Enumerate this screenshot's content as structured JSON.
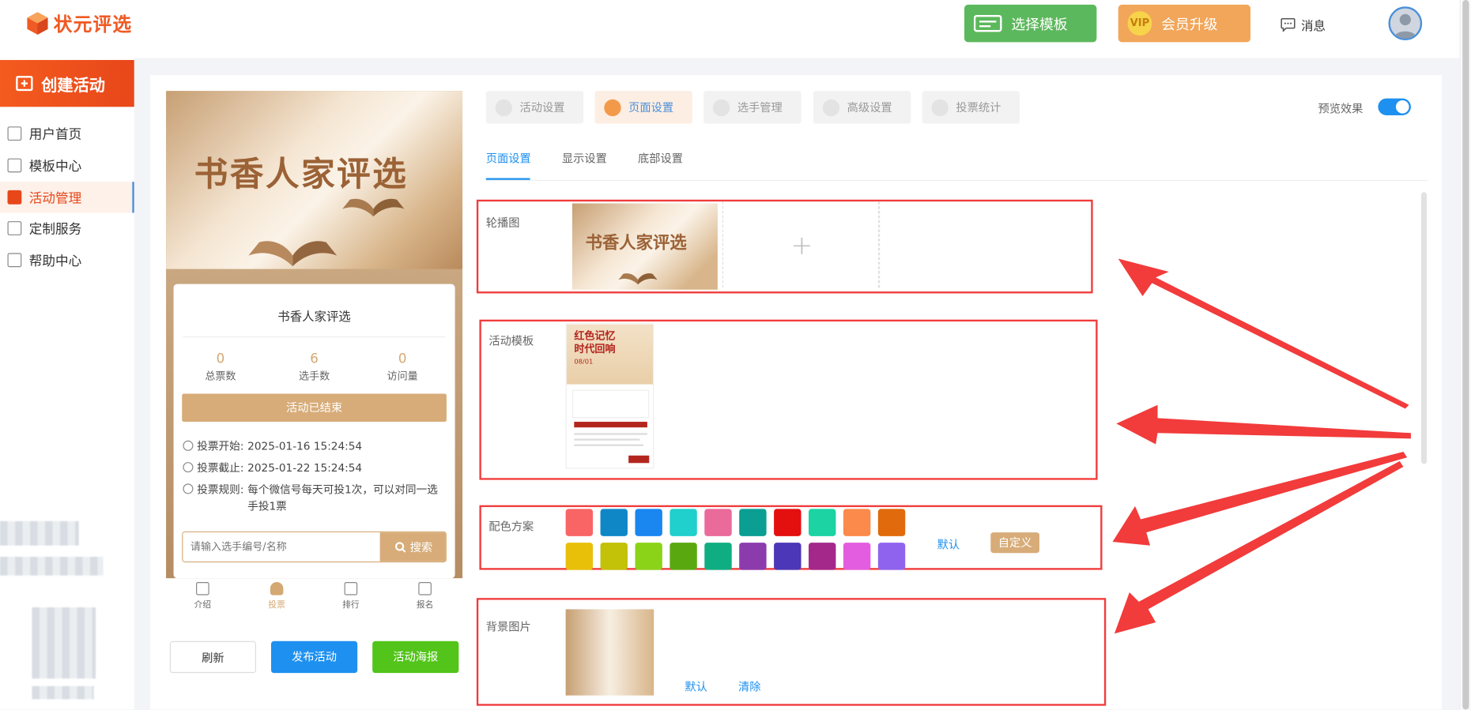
{
  "brand": {
    "name": "状元评选"
  },
  "topbar": {
    "choose_template": "选择模板",
    "vip_upgrade": "会员升级",
    "vip_badge": "VIP",
    "messages": "消息"
  },
  "sidebar": {
    "create": "创建活动",
    "items": [
      {
        "label": "用户首页",
        "icon": "home-icon"
      },
      {
        "label": "模板中心",
        "icon": "folder-icon"
      },
      {
        "label": "活动管理",
        "icon": "ticket-icon",
        "active": true
      },
      {
        "label": "定制服务",
        "icon": "tools-icon"
      },
      {
        "label": "帮助中心",
        "icon": "help-icon"
      }
    ]
  },
  "preview": {
    "banner_title": "书香人家评选",
    "activity_title": "书香人家评选",
    "stats": [
      {
        "value": "0",
        "label": "总票数"
      },
      {
        "value": "6",
        "label": "选手数"
      },
      {
        "value": "0",
        "label": "访问量"
      }
    ],
    "status": "活动已结束",
    "vote_start_label": "投票开始:",
    "vote_start": "2025-01-16 15:24:54",
    "vote_end_label": "投票截止:",
    "vote_end": "2025-01-22 15:24:54",
    "rule_label": "投票规则:",
    "rule": "每个微信号每天可投1次，可以对同一选手投1票",
    "search_placeholder": "请输入选手编号/名称",
    "search_button": "搜索",
    "tabs": [
      "介绍",
      "投票",
      "排行",
      "报名"
    ],
    "active_tab": "投票"
  },
  "actions": {
    "refresh": "刷新",
    "publish": "发布活动",
    "poster": "活动海报"
  },
  "settings": {
    "main_tabs": [
      "活动设置",
      "页面设置",
      "选手管理",
      "高级设置",
      "投票统计"
    ],
    "active_main_tab": "页面设置",
    "preview_effect": "预览效果",
    "preview_on": true,
    "sub_tabs": [
      "页面设置",
      "显示设置",
      "底部设置"
    ],
    "active_sub_tab": "页面设置",
    "carousel_label": "轮播图",
    "carousel_thumb_title": "书香人家评选",
    "template_label": "活动模板",
    "template_thumb": {
      "title_line1": "红色记忆",
      "title_line2": "时代回响",
      "date": "08/01"
    },
    "color_label": "配色方案",
    "colors": [
      "#f96565",
      "#0f87c6",
      "#1a86f0",
      "#1fd0cc",
      "#ea6a9a",
      "#0b9e93",
      "#e40f0f",
      "#1bd3a3",
      "#fb8a4b",
      "#e06a0c",
      "#e8c00a",
      "#c3c108",
      "#8bd318",
      "#5aa80f",
      "#0fae82",
      "#8c3bad",
      "#4b37b7",
      "#a4288a",
      "#e35de0",
      "#8f63ee"
    ],
    "color_default": "默认",
    "color_custom": "自定义",
    "bg_label": "背景图片",
    "bg_default": "默认",
    "bg_clear": "清除"
  }
}
